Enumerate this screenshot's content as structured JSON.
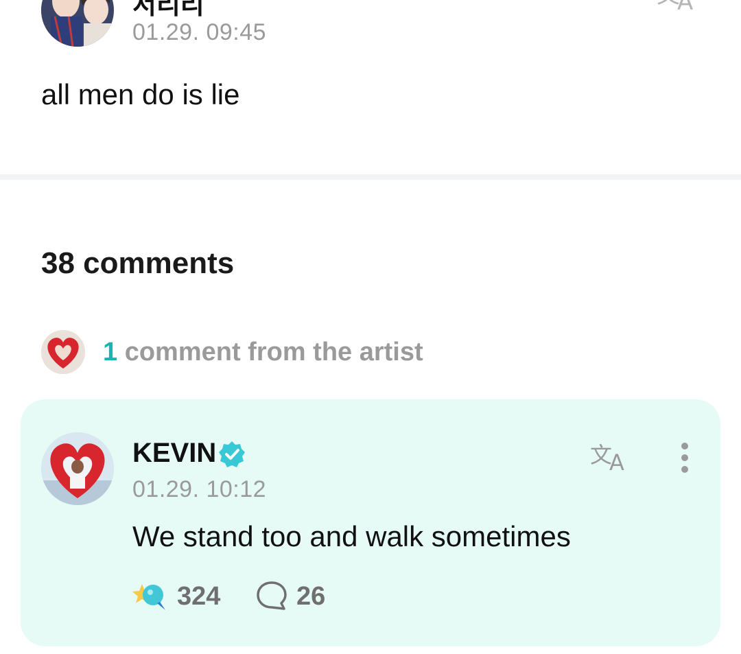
{
  "post": {
    "author": "서리리",
    "timestamp": "01.29. 09:45",
    "body": "all men do is lie",
    "translate_icon": "translate-icon"
  },
  "comments": {
    "count_label": "38 comments",
    "artist_summary": {
      "count": "1",
      "text": " comment from the artist"
    },
    "artist_comment": {
      "author": "KEVIN",
      "verified_icon": "verified-badge-icon",
      "timestamp": "01.29. 10:12",
      "text": "We stand too and walk sometimes",
      "likes": "324",
      "replies": "26",
      "icons": [
        "translate-icon",
        "more-vertical-icon",
        "like-icon",
        "reply-icon"
      ]
    }
  },
  "colors": {
    "accent": "#1ab3b3",
    "card_background": "#e6fbf6",
    "muted_text": "#9a9a9a",
    "verified_badge": "#39c9d6"
  }
}
